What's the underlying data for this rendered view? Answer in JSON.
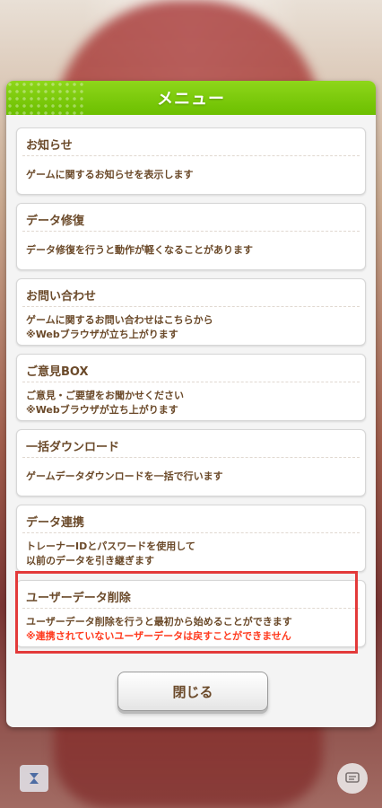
{
  "dialog": {
    "title": "メニュー",
    "items": [
      {
        "title": "お知らせ",
        "desc": "ゲームに関するお知らせを表示します"
      },
      {
        "title": "データ修復",
        "desc": "データ修復を行うと動作が軽くなることがあります"
      },
      {
        "title": "お問い合わせ",
        "desc1": "ゲームに関するお問い合わせはこちらから",
        "desc2": "※Webブラウザが立ち上がります"
      },
      {
        "title": "ご意見BOX",
        "desc1": "ご意見・ご要望をお聞かせください",
        "desc2": "※Webブラウザが立ち上がります"
      },
      {
        "title": "一括ダウンロード",
        "desc": "ゲームデータダウンロードを一括で行います"
      },
      {
        "title": "データ連携",
        "desc1": "トレーナーIDとパスワードを使用して",
        "desc2": "以前のデータを引き継ぎます"
      },
      {
        "title": "ユーザーデータ削除",
        "desc1": "ユーザーデータ削除を行うと最初から始めることができます",
        "warning": "※連携されていないユーザーデータは戻すことができません"
      }
    ],
    "close_label": "閉じる"
  },
  "icons": {
    "left_corner": "app-menu-icon",
    "right_corner": "chat-icon"
  },
  "colors": {
    "header_green": "#7ccb0a",
    "text_brown": "#6b4a2a",
    "warning_red": "#ff3b1f",
    "highlight_red": "#e33a3a"
  }
}
